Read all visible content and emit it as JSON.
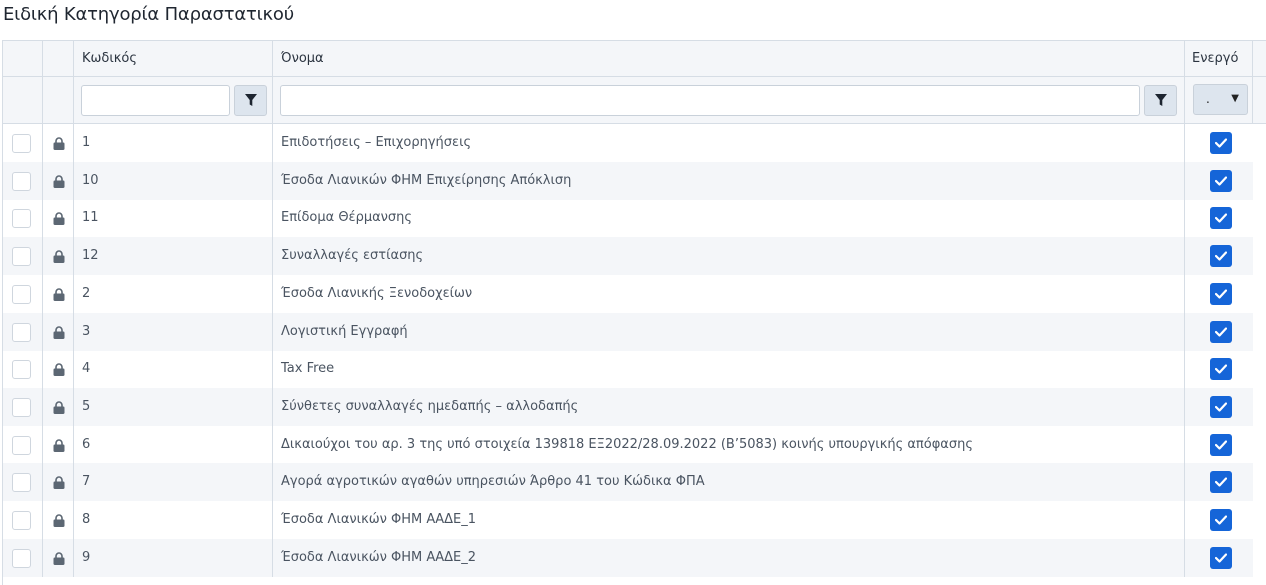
{
  "page": {
    "title": "Ειδική Κατηγορία Παραστατικού"
  },
  "columns": {
    "code": "Κωδικός",
    "name": "Όνομα",
    "active": "Ενεργό"
  },
  "filters": {
    "code_value": "",
    "name_value": "",
    "active_selected": "."
  },
  "colors": {
    "accent": "#1565d8",
    "alt_row": "#f4f6f9",
    "border": "#d6dde5"
  },
  "icons": {
    "filter": "filter-icon",
    "lock": "lock-icon",
    "check": "check-icon",
    "caret": "chevron-down-icon"
  },
  "rows": [
    {
      "code": "1",
      "name": "Επιδοτήσεις – Επιχορηγήσεις",
      "active": true
    },
    {
      "code": "10",
      "name": "Έσοδα Λιανικών ΦΗΜ Επιχείρησης Απόκλιση",
      "active": true
    },
    {
      "code": "11",
      "name": "Επίδομα Θέρμανσης",
      "active": true
    },
    {
      "code": "12",
      "name": "Συναλλαγές εστίασης",
      "active": true
    },
    {
      "code": "2",
      "name": "Έσοδα Λιανικής Ξενοδοχείων",
      "active": true
    },
    {
      "code": "3",
      "name": "Λογιστική Εγγραφή",
      "active": true
    },
    {
      "code": "4",
      "name": "Tax Free",
      "active": true
    },
    {
      "code": "5",
      "name": "Σύνθετες συναλλαγές ημεδαπής – αλλοδαπής",
      "active": true
    },
    {
      "code": "6",
      "name": "Δικαιούχοι του αρ. 3 της υπό στοιχεία 139818 ΕΞ2022/28.09.2022 (Β’5083) κοινής υπουργικής απόφασης",
      "active": true
    },
    {
      "code": "7",
      "name": "Αγορά αγροτικών αγαθών υπηρεσιών Άρθρο 41 του Κώδικα ΦΠΑ",
      "active": true
    },
    {
      "code": "8",
      "name": "Έσοδα Λιανικών ΦΗΜ ΑΑΔΕ_1",
      "active": true
    },
    {
      "code": "9",
      "name": "Έσοδα Λιανικών ΦΗΜ ΑΑΔΕ_2",
      "active": true
    }
  ]
}
